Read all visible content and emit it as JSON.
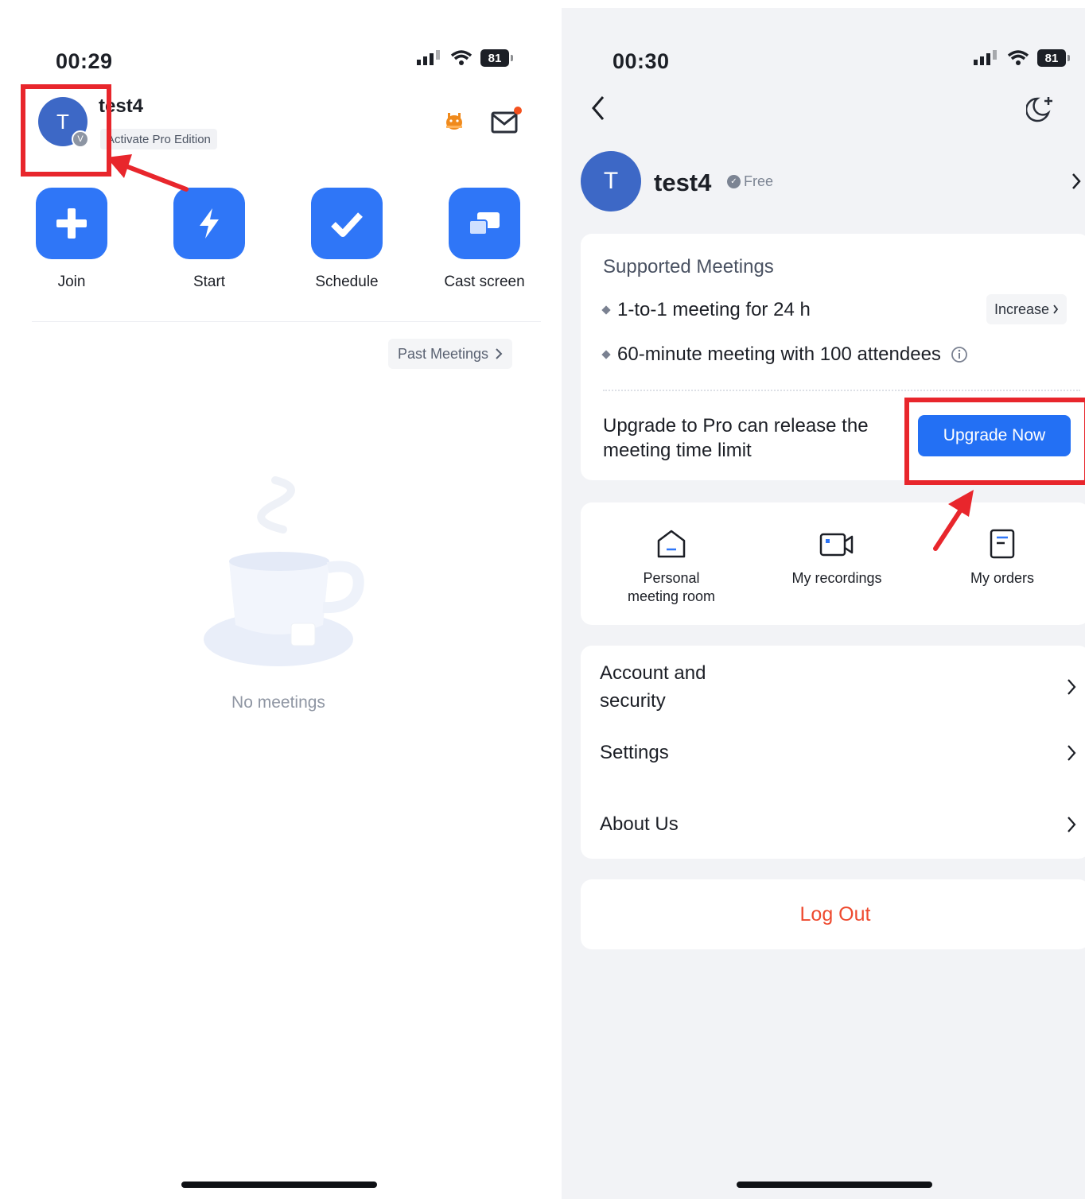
{
  "left_screen": {
    "status_time": "00:29",
    "battery": "81",
    "avatar_initial": "T",
    "avatar_badge": "V",
    "username": "test4",
    "pro_tag": "Activate Pro Edition",
    "actions": [
      {
        "label": "Join",
        "icon": "plus-icon"
      },
      {
        "label": "Start",
        "icon": "lightning-icon"
      },
      {
        "label": "Schedule",
        "icon": "checkmark-icon"
      },
      {
        "label": "Cast screen",
        "icon": "cast-screen-icon"
      }
    ],
    "past_meetings": "Past Meetings",
    "empty_state": "No meetings"
  },
  "right_screen": {
    "status_time": "00:30",
    "battery": "81",
    "avatar_initial": "T",
    "username": "test4",
    "plan_badge": "Free",
    "supported_title": "Supported Meetings",
    "meeting_items": [
      "1-to-1 meeting for 24 h",
      "60-minute meeting with 100 attendees"
    ],
    "increase_label": "Increase",
    "upgrade_text": "Upgrade to Pro can release the meeting time limit",
    "upgrade_button": "Upgrade Now",
    "features": [
      {
        "label": "Personal meeting room",
        "icon": "house-icon"
      },
      {
        "label": "My recordings",
        "icon": "video-camera-icon"
      },
      {
        "label": "My orders",
        "icon": "document-icon"
      }
    ],
    "menu": [
      {
        "label": "Account and security"
      },
      {
        "label": "Settings"
      },
      {
        "label": "About Us"
      }
    ],
    "logout": "Log Out"
  },
  "colors": {
    "primary_blue": "#2f76f7",
    "avatar_blue": "#3d68c6",
    "annotation_red": "#e8262c",
    "logout_red": "#ee4a2f",
    "background_grey": "#f2f3f6"
  }
}
